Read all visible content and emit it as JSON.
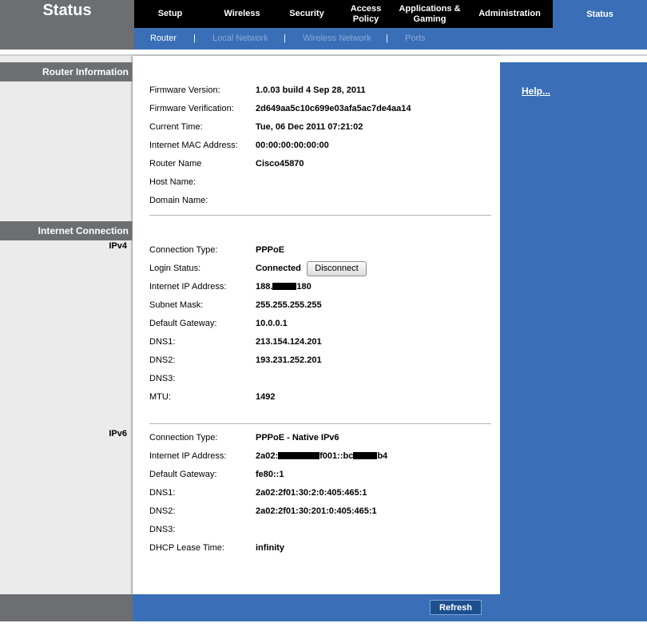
{
  "header": {
    "title": "Status",
    "nav": [
      {
        "label": "Setup"
      },
      {
        "label": "Wireless"
      },
      {
        "label": "Security"
      },
      {
        "label": "Access Policy"
      },
      {
        "label": "Applications & Gaming"
      },
      {
        "label": "Administration"
      }
    ],
    "active_nav": "Status",
    "subnav": [
      {
        "label": "Router"
      },
      {
        "label": "Local Network"
      },
      {
        "label": "Wireless Network"
      },
      {
        "label": "Ports"
      }
    ],
    "separator": "|"
  },
  "sidebar": {
    "router_info": "Router Information",
    "internet_connection": "Internet Connection",
    "ipv4": "IPv4",
    "ipv6": "IPv6"
  },
  "help": {
    "label": "Help..."
  },
  "router_info": {
    "firmware_version_label": "Firmware Version:",
    "firmware_version": "1.0.03 build 4  Sep 28, 2011",
    "firmware_verification_label": "Firmware Verification:",
    "firmware_verification": "2d649aa5c10c699e03afa5ac7de4aa14",
    "current_time_label": "Current Time:",
    "current_time": "Tue, 06 Dec 2011 07:21:02",
    "mac_label": "Internet MAC Address:",
    "mac": "00:00:00:00:00:00",
    "router_name_label": "Router Name",
    "router_name": "Cisco45870",
    "host_name_label": "Host Name:",
    "domain_name_label": "Domain Name:"
  },
  "ipv4": {
    "conn_type_label": "Connection Type:",
    "conn_type": "PPPoE",
    "login_status_label": "Login Status:",
    "login_status": "Connected",
    "disconnect_label": "Disconnect",
    "ip_label": "Internet IP Address:",
    "ip_prefix": "188.",
    "ip_suffix": "180",
    "subnet_label": "Subnet Mask:",
    "subnet": "255.255.255.255",
    "gateway_label": "Default Gateway:",
    "gateway": "10.0.0.1",
    "dns1_label": "DNS1:",
    "dns1": "213.154.124.201",
    "dns2_label": "DNS2:",
    "dns2": "193.231.252.201",
    "dns3_label": "DNS3:",
    "mtu_label": "MTU:",
    "mtu": "1492"
  },
  "ipv6": {
    "conn_type_label": "Connection Type:",
    "conn_type": "PPPoE - Native IPv6",
    "ip_label": "Internet IP Address:",
    "ip_part1": "2a02:",
    "ip_part2": "f001::bc",
    "ip_part3": "b4",
    "gateway_label": "Default Gateway:",
    "gateway": "fe80::1",
    "dns1_label": "DNS1:",
    "dns1": "2a02:2f01:30:2:0:405:465:1",
    "dns2_label": "DNS2:",
    "dns2": "2a02:2f01:30:201:0:405:465:1",
    "dns3_label": "DNS3:",
    "lease_label": "DHCP Lease Time:",
    "lease": "infinity"
  },
  "footer": {
    "refresh_label": "Refresh"
  }
}
